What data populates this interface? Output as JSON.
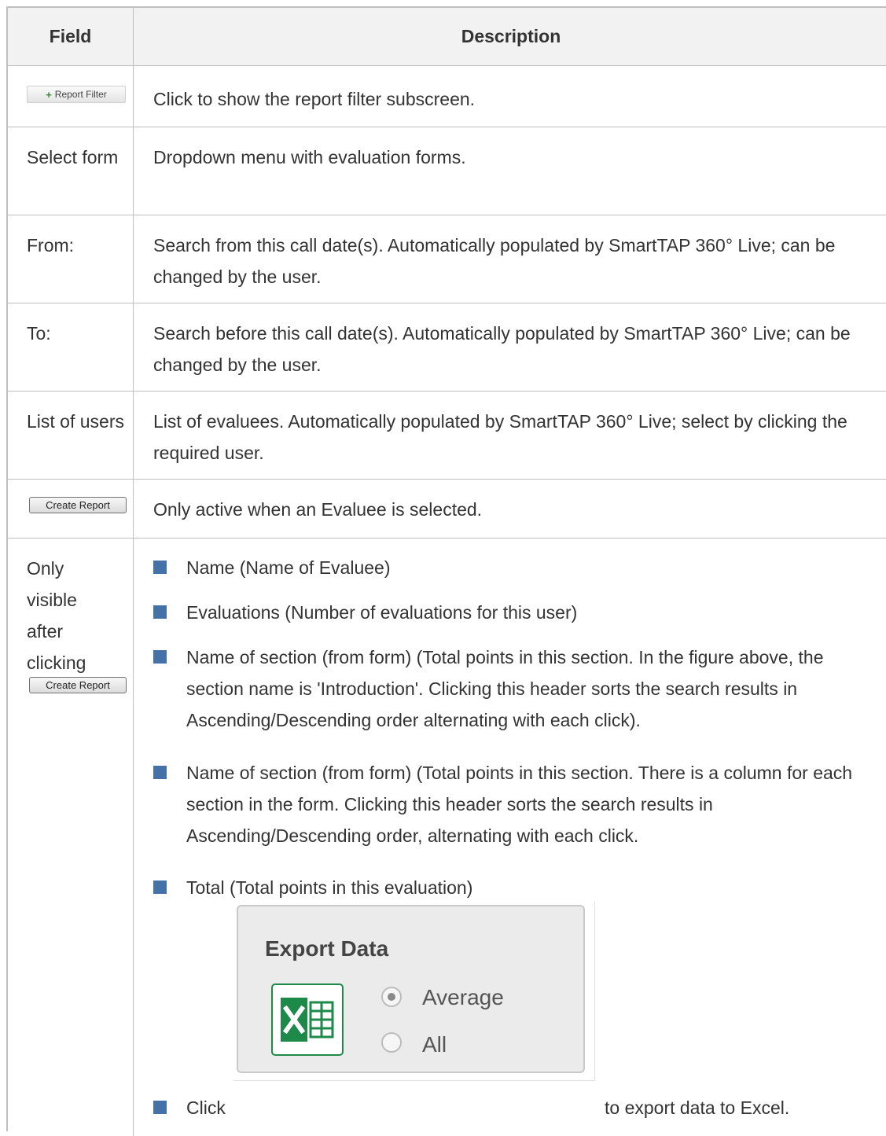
{
  "table": {
    "header": {
      "field": "Field",
      "description": "Description"
    },
    "rows": [
      {
        "description": "Click to show the report filter subscreen."
      },
      {
        "field": "Select form",
        "description": "Dropdown menu with evaluation forms."
      },
      {
        "field": "From:",
        "description": "Search from this call date(s). Automatically populated by SmartTAP 360° Live; can be changed by the user."
      },
      {
        "field": "To:",
        "description": "Search before this call date(s). Automatically populated by SmartTAP 360° Live; can be changed by the user."
      },
      {
        "field": "List of users",
        "description": "List of evaluees. Automatically populated by SmartTAP 360° Live; select by clicking the required user."
      },
      {
        "description": "Only active when an Evaluee is selected."
      },
      {
        "field": "Only visible after clicking"
      }
    ],
    "bullets": [
      "Name (Name of Evaluee)",
      "Evaluations (Number of evaluations for this user)",
      "Name of section (from form) (Total points in this section. In the figure above, the section name is 'Introduction'. Clicking this header sorts the search results in Ascending/Descending order alternating with each click).",
      "Name of section (from form) (Total points in this section. There is a column for each section in the form. Clicking this header sorts the search results in Ascending/Descending order, alternating with each click.",
      "Total (Total points in this evaluation)"
    ],
    "export_bullet": {
      "before": "Click",
      "after": "to export data to Excel."
    }
  },
  "buttons": {
    "report_filter": "Report Filter",
    "create_report": "Create Report"
  },
  "export_panel": {
    "title": "Export Data",
    "options": [
      "Average",
      "All"
    ],
    "selected": "Average",
    "icon": "excel-icon"
  },
  "colors": {
    "bullet": "#4472a8",
    "excel_green": "#1e8a4a"
  }
}
